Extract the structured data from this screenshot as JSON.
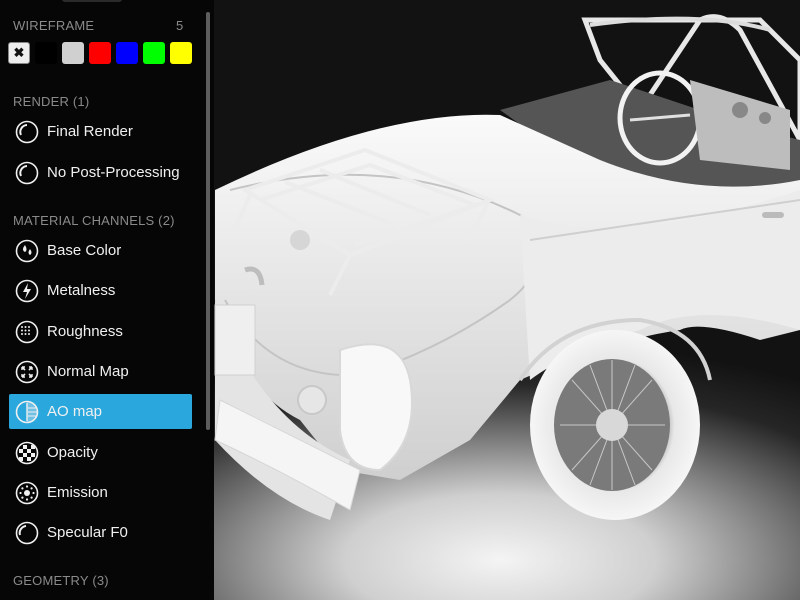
{
  "wireframe": {
    "title": "WIREFRAME",
    "count": "5",
    "swatches": [
      {
        "name": "none",
        "color": "#eeeeee",
        "selected": true
      },
      {
        "name": "black",
        "color": "#000000"
      },
      {
        "name": "light-gray",
        "color": "#d0d0d0"
      },
      {
        "name": "red",
        "color": "#ff0000"
      },
      {
        "name": "blue",
        "color": "#0000ff"
      },
      {
        "name": "green",
        "color": "#00ff00"
      },
      {
        "name": "yellow",
        "color": "#ffff00"
      }
    ]
  },
  "render": {
    "title": "RENDER (1)",
    "items": [
      {
        "label": "Final Render",
        "icon": "final-render-icon"
      },
      {
        "label": "No Post-Processing",
        "icon": "no-post-processing-icon"
      }
    ]
  },
  "material_channels": {
    "title": "MATERIAL CHANNELS (2)",
    "items": [
      {
        "label": "Base Color",
        "icon": "base-color-icon"
      },
      {
        "label": "Metalness",
        "icon": "metalness-icon"
      },
      {
        "label": "Roughness",
        "icon": "roughness-icon"
      },
      {
        "label": "Normal Map",
        "icon": "normal-map-icon"
      },
      {
        "label": "AO map",
        "icon": "ao-map-icon",
        "active": true
      },
      {
        "label": "Opacity",
        "icon": "opacity-icon"
      },
      {
        "label": "Emission",
        "icon": "emission-icon"
      },
      {
        "label": "Specular F0",
        "icon": "specular-f0-icon"
      }
    ]
  },
  "geometry": {
    "title": "GEOMETRY (3)"
  },
  "colors": {
    "accent": "#2aa7dc",
    "sidebar_bg": "#060606"
  }
}
